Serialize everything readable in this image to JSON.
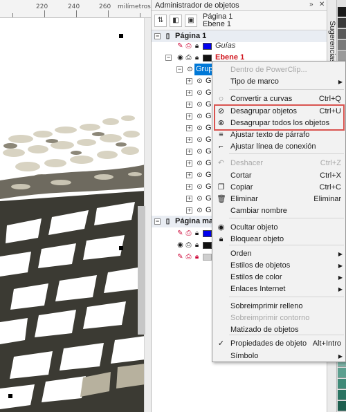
{
  "ruler": {
    "labels": [
      "220",
      "240",
      "260",
      "milímetros"
    ]
  },
  "docker": {
    "title": "Administrador de objetos",
    "page_name": "Página 1",
    "layer_name": "Ebene 1"
  },
  "sidebar_tab": "Sugerencias",
  "tree": {
    "page1": "Página 1",
    "guias": "Guías",
    "ebene1": "Ebene 1",
    "grupo_selected": "Grupo de 12 objetos",
    "item_prefix": "Gr",
    "master_page": "Página maestra"
  },
  "colors": {
    "accent": "#0078d7",
    "highlight_border": "#d9534f",
    "layer_red": "#d0121b"
  },
  "context_menu": {
    "items": [
      {
        "label": "Dentro de PowerClip...",
        "shortcut": "",
        "disabled": true,
        "submenu": false
      },
      {
        "label": "Tipo de marco",
        "shortcut": "",
        "disabled": false,
        "submenu": true
      },
      {
        "label": "Convertir a curvas",
        "shortcut": "Ctrl+Q",
        "disabled": false,
        "submenu": false
      },
      {
        "label": "Desagrupar objetos",
        "shortcut": "Ctrl+U",
        "disabled": false,
        "submenu": false
      },
      {
        "label": "Desagrupar todos los objetos",
        "shortcut": "",
        "disabled": false,
        "submenu": false
      },
      {
        "label": "Ajustar texto de párrafo",
        "shortcut": "",
        "disabled": false,
        "submenu": false
      },
      {
        "label": "Ajustar línea de conexión",
        "shortcut": "",
        "disabled": false,
        "submenu": false
      },
      {
        "label": "Deshacer",
        "shortcut": "Ctrl+Z",
        "disabled": true,
        "submenu": false
      },
      {
        "label": "Cortar",
        "shortcut": "Ctrl+X",
        "disabled": false,
        "submenu": false
      },
      {
        "label": "Copiar",
        "shortcut": "Ctrl+C",
        "disabled": false,
        "submenu": false
      },
      {
        "label": "Eliminar",
        "shortcut": "Eliminar",
        "disabled": false,
        "submenu": false
      },
      {
        "label": "Cambiar nombre",
        "shortcut": "",
        "disabled": false,
        "submenu": false
      },
      {
        "label": "Ocultar objeto",
        "shortcut": "",
        "disabled": false,
        "submenu": false
      },
      {
        "label": "Bloquear objeto",
        "shortcut": "",
        "disabled": false,
        "submenu": false
      },
      {
        "label": "Orden",
        "shortcut": "",
        "disabled": false,
        "submenu": true
      },
      {
        "label": "Estilos de objetos",
        "shortcut": "",
        "disabled": false,
        "submenu": true
      },
      {
        "label": "Estilos de color",
        "shortcut": "",
        "disabled": false,
        "submenu": true
      },
      {
        "label": "Enlaces Internet",
        "shortcut": "",
        "disabled": false,
        "submenu": true
      },
      {
        "label": "Sobreimprimir relleno",
        "shortcut": "",
        "disabled": false,
        "submenu": false
      },
      {
        "label": "Sobreimprimir contorno",
        "shortcut": "",
        "disabled": true,
        "submenu": false
      },
      {
        "label": "Matizado de objetos",
        "shortcut": "",
        "disabled": false,
        "submenu": false
      },
      {
        "label": "Propiedades de objeto",
        "shortcut": "Alt+Intro",
        "disabled": false,
        "submenu": false
      },
      {
        "label": "Símbolo",
        "shortcut": "",
        "disabled": false,
        "submenu": true
      }
    ]
  }
}
